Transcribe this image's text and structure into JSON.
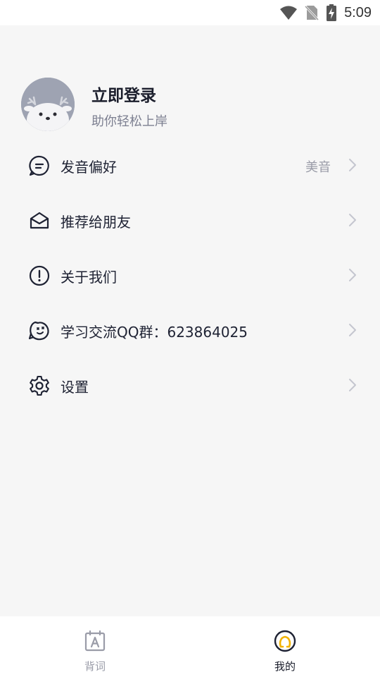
{
  "status_bar": {
    "time": "5:09",
    "icons": [
      "wifi-icon",
      "no-sim-icon",
      "battery-charging-icon"
    ]
  },
  "profile": {
    "title": "立即登录",
    "subtitle": "助你轻松上岸",
    "avatar_icon": "deer-avatar-icon"
  },
  "menu": {
    "items": [
      {
        "label": "发音偏好",
        "value": "美音",
        "icon": "chat-bubble-icon"
      },
      {
        "label": "推荐给朋友",
        "icon": "envelope-icon"
      },
      {
        "label": "关于我们",
        "icon": "exclamation-circle-icon"
      },
      {
        "label": "学习交流QQ群：623864025",
        "icon": "group-chat-icon"
      },
      {
        "label": "设置",
        "icon": "gear-icon"
      }
    ]
  },
  "bottom_nav": {
    "tabs": [
      {
        "label": "背词",
        "icon": "calendar-a-icon",
        "active": false
      },
      {
        "label": "我的",
        "icon": "profile-circle-icon",
        "active": true
      }
    ],
    "active_color": "#f2b200",
    "inactive_color": "#9a9ca8"
  }
}
